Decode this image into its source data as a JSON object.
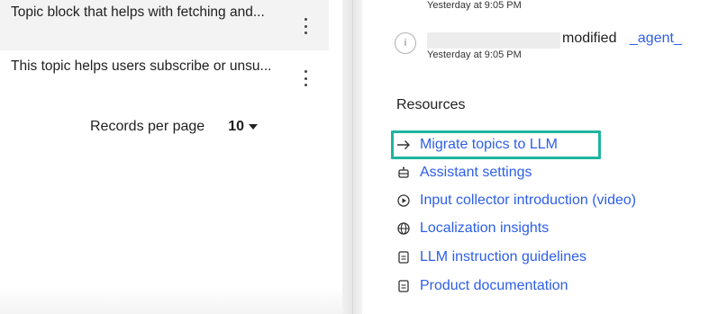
{
  "topics": [
    {
      "text": "Topic block that helps with fetching and..."
    },
    {
      "text": "This topic helps users subscribe or unsu..."
    }
  ],
  "pager": {
    "label": "Records per page",
    "value": "10"
  },
  "activity": {
    "time_top": "Yesterday at 9:05 PM",
    "verb": "modified",
    "agent": "_agent_",
    "time": "Yesterday at 9:05 PM"
  },
  "resources": {
    "heading": "Resources",
    "items": [
      {
        "label": "Migrate topics to LLM",
        "icon": "arrow-right-icon"
      },
      {
        "label": "Assistant settings",
        "icon": "robot-icon"
      },
      {
        "label": "Input collector introduction (video)",
        "icon": "play-circle-icon"
      },
      {
        "label": "Localization insights",
        "icon": "globe-icon"
      },
      {
        "label": "LLM instruction guidelines",
        "icon": "document-icon"
      },
      {
        "label": "Product documentation",
        "icon": "document-icon"
      }
    ]
  },
  "colors": {
    "link": "#2d5ee8",
    "highlight": "#1fb5a0"
  }
}
